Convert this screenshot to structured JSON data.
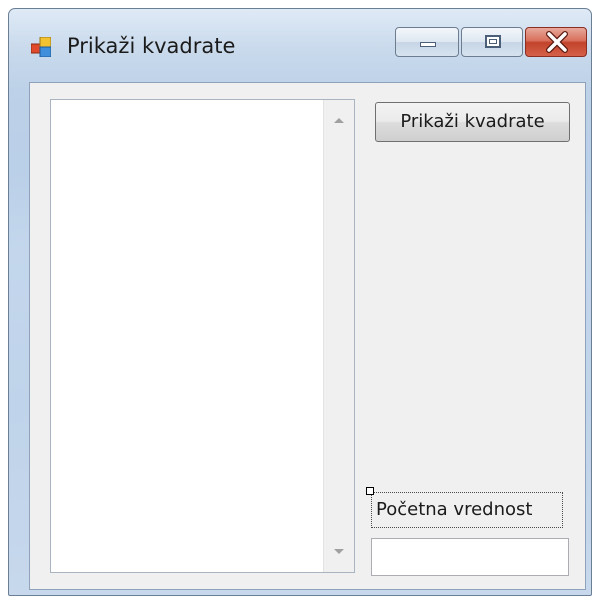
{
  "window": {
    "title": "Prikaži kvadrate",
    "icons": {
      "app": "app-window-icon",
      "minimize": "minimize-icon",
      "maximize": "maximize-icon",
      "close": "close-icon"
    },
    "colors": {
      "frame": "#bcd1e8",
      "client_background": "#f0f0f0",
      "close_button": "#c7432b"
    }
  },
  "form": {
    "listbox": {
      "items": [],
      "scroll_up_icon": "scroll-up-arrow-icon",
      "scroll_down_icon": "scroll-down-arrow-icon"
    },
    "show_button_label": "Prikaži kvadrate",
    "start_label": "Početna vrednost",
    "start_input": {
      "value": "",
      "placeholder": ""
    }
  }
}
